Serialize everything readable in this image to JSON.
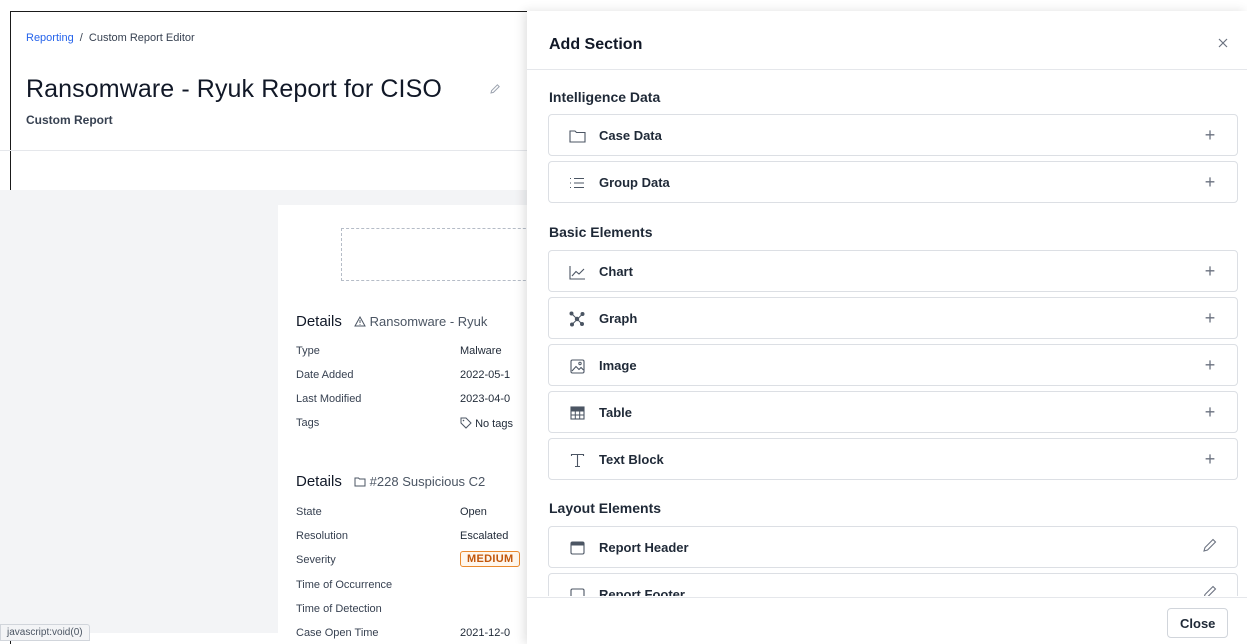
{
  "breadcrumb": {
    "root": "Reporting",
    "separator": "/",
    "current": "Custom Report Editor"
  },
  "page": {
    "title": "Ransomware - Ryuk Report for CISO",
    "subtitle": "Custom Report"
  },
  "report": {
    "details1": {
      "title": "Details",
      "subject": "Ransomware - Ryuk",
      "subject_icon": "warning-triangle-icon",
      "rows": [
        {
          "label": "Type",
          "value": "Malware"
        },
        {
          "label": "Date Added",
          "value": "2022-05-1"
        },
        {
          "label": "Last Modified",
          "value": "2023-04-0"
        },
        {
          "label": "Tags",
          "value": "No tags"
        }
      ]
    },
    "details2": {
      "title": "Details",
      "subject": "#228 Suspicious C2",
      "subject_icon": "folder-icon",
      "rows": [
        {
          "label": "State",
          "value": "Open"
        },
        {
          "label": "Resolution",
          "value": "Escalated"
        },
        {
          "label": "Severity",
          "value": "MEDIUM"
        },
        {
          "label": "Time of Occurrence",
          "value": ""
        },
        {
          "label": "Time of Detection",
          "value": ""
        },
        {
          "label": "Case Open Time",
          "value": "2021-12-0"
        }
      ]
    }
  },
  "status_bar": "javascript:void(0)",
  "drawer": {
    "title": "Add Section",
    "close_label": "Close",
    "groups": [
      {
        "heading": "Intelligence Data",
        "items": [
          {
            "label": "Case Data",
            "icon": "folder-icon",
            "action": "+"
          },
          {
            "label": "Group Data",
            "icon": "list-icon",
            "action": "+"
          }
        ]
      },
      {
        "heading": "Basic Elements",
        "items": [
          {
            "label": "Chart",
            "icon": "line-chart-icon",
            "action": "+"
          },
          {
            "label": "Graph",
            "icon": "graph-icon",
            "action": "+"
          },
          {
            "label": "Image",
            "icon": "image-icon",
            "action": "+"
          },
          {
            "label": "Table",
            "icon": "table-icon",
            "action": "+"
          },
          {
            "label": "Text Block",
            "icon": "text-icon",
            "action": "+"
          }
        ]
      },
      {
        "heading": "Layout Elements",
        "items": [
          {
            "label": "Report Header",
            "icon": "header-icon",
            "action": "edit"
          },
          {
            "label": "Report Footer",
            "icon": "footer-icon",
            "action": "edit"
          }
        ]
      }
    ]
  },
  "colors": {
    "accent": "#2563eb",
    "severity_medium": "#ea8a2e"
  }
}
